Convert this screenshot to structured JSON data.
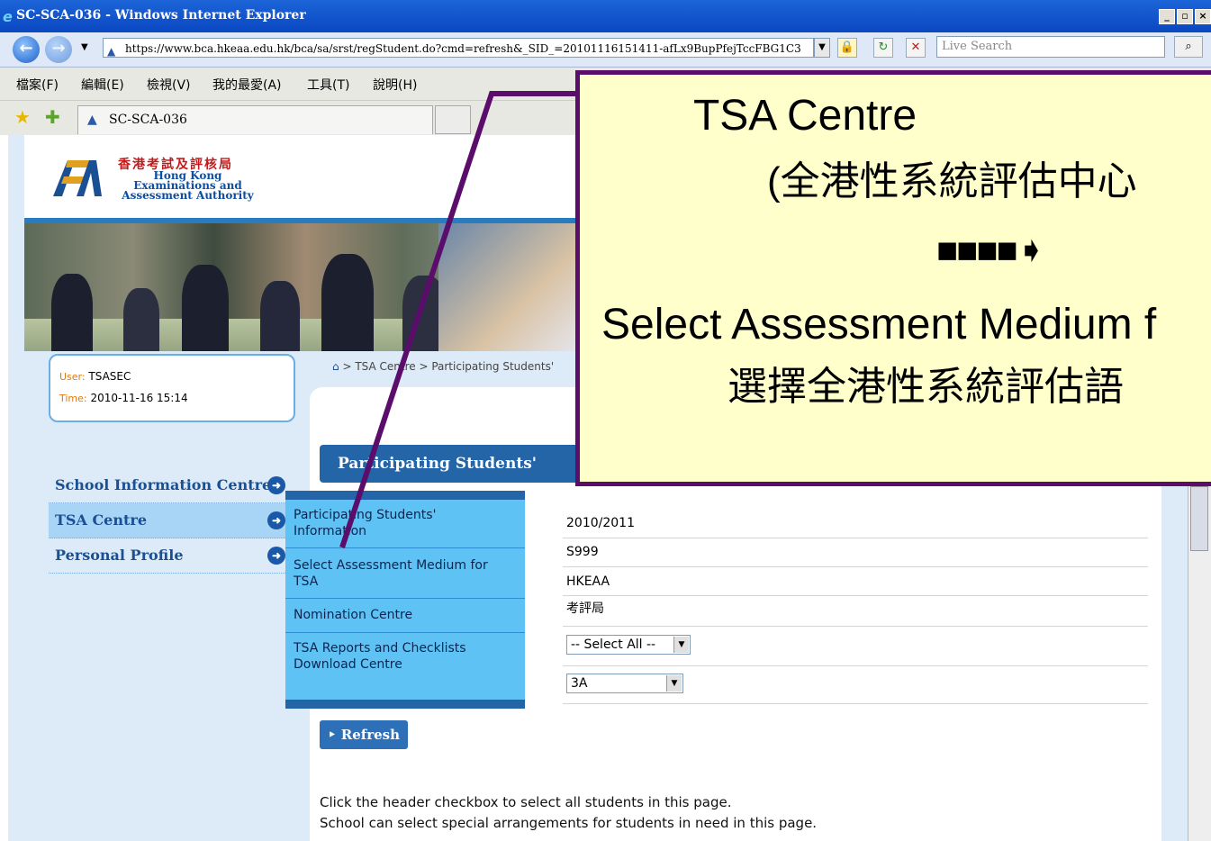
{
  "window": {
    "title": "SC-SCA-036 - Windows Internet Explorer",
    "url": "https://www.bca.hkeaa.edu.hk/bca/sa/srst/regStudent.do?cmd=refresh&_SID_=20101116151411-afLx9BupPfejTccFBG1C3",
    "search_placeholder": "Live Search",
    "tab_title": "SC-SCA-036"
  },
  "menu": [
    "檔案(F)",
    "編輯(E)",
    "檢視(V)",
    "我的最愛(A)",
    "工具(T)",
    "說明(H)"
  ],
  "header": {
    "org_cn": "香港考試及評核局",
    "org_en_1": "Hong Kong",
    "org_en_2": "Examinations and",
    "org_en_3": "Assessment Authority"
  },
  "user": {
    "user_label": "User:",
    "user_value": "TSASEC",
    "time_label": "Time:",
    "time_value": "2010-11-16 15:14"
  },
  "breadcrumb": "> TSA Centre  > Participating Students'",
  "section_title": "Participating Students' Information",
  "left_nav": [
    {
      "label": "School Information Centre"
    },
    {
      "label": "TSA Centre"
    },
    {
      "label": "Personal Profile"
    }
  ],
  "flyout": [
    {
      "label": "Participating Students'\nInformation"
    },
    {
      "label": "Select Assessment Medium for\nTSA"
    },
    {
      "label": "Nomination Centre"
    },
    {
      "label": "TSA Reports and Checklists\nDownload Centre"
    }
  ],
  "form": {
    "year": "2010/2011",
    "school_code": "S999",
    "school_name_en": "HKEAA",
    "school_name_cn": "考評局",
    "level_select": "-- Select All --",
    "class_select": "3A"
  },
  "buttons": {
    "refresh": "Refresh"
  },
  "notes": [
    "Click the header checkbox to select all students in this page.",
    "School can select special arrangements for students in need in this page."
  ],
  "callout": {
    "line1": "TSA Centre",
    "line2": "(全港性系統評估中心",
    "arrow": "■■■■➧",
    "line3": "Select Assessment Medium f",
    "line4": "選擇全港性系統評估語"
  },
  "colors": {
    "title_bar": "#0a47c1",
    "brand_blue": "#2465a8",
    "flyout_bg": "#5ec3f4",
    "callout_bg": "#ffffcc",
    "callout_border": "#5b0d6b"
  }
}
